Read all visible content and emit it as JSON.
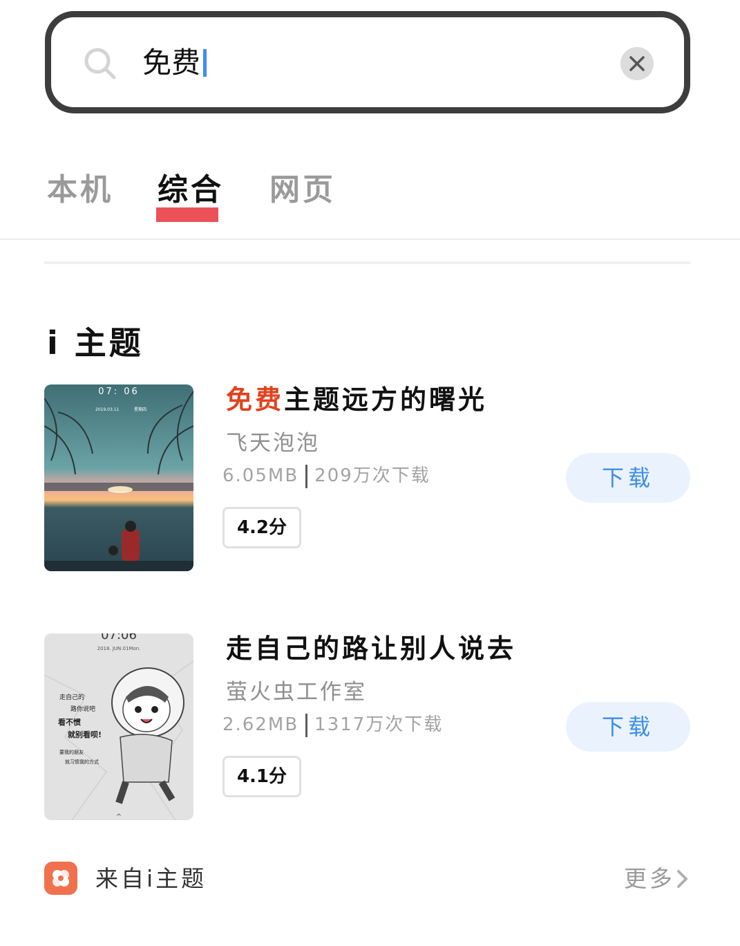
{
  "search": {
    "query": "免费"
  },
  "tabs": [
    {
      "label": "本机",
      "active": false
    },
    {
      "label": "综合",
      "active": true
    },
    {
      "label": "网页",
      "active": false
    }
  ],
  "section": {
    "title": "i 主题"
  },
  "items": [
    {
      "title_highlight": "免费",
      "title_rest": "主题远方的曙光",
      "author": "飞天泡泡",
      "size": "6.05MB",
      "downloads": "209万次下载",
      "rating": "4.2分",
      "button": "下载",
      "thumb_time": "07: 06",
      "thumb_date": "2019.03.11",
      "thumb_day": "星期四"
    },
    {
      "title_highlight": "",
      "title_rest": "走自己的路让别人说去",
      "author": "萤火虫工作室",
      "size": "2.62MB",
      "downloads": "1317万次下载",
      "rating": "4.1分",
      "button": "下载",
      "thumb_time": "07:06",
      "thumb_date": "2018. JUN.01Mon.",
      "thumb_lines": [
        "走自己的",
        "路你说吧",
        "看不惯",
        "就别看呗!",
        "要我的朋友",
        "就习惯我的方式"
      ]
    }
  ],
  "footer": {
    "source": "来自i主题",
    "more": "更多"
  },
  "colors": {
    "highlight": "#e3421e",
    "tab_underline": "#ec5158",
    "button_text": "#3d8ce8",
    "button_bg": "#eaf3fd",
    "app_icon": "#f0714d"
  }
}
